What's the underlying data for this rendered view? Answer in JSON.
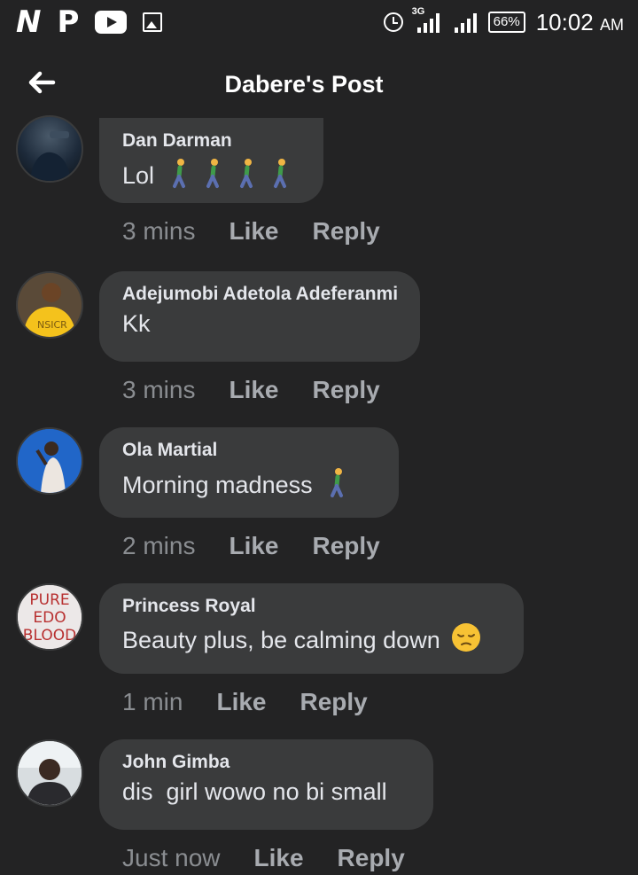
{
  "status_bar": {
    "app_icons": [
      "N",
      "P"
    ],
    "network_type": "3G",
    "battery": "66%",
    "time": "10:02",
    "ampm": "AM"
  },
  "header": {
    "title": "Dabere's Post"
  },
  "actions": {
    "like": "Like",
    "reply": "Reply"
  },
  "comments": [
    {
      "author": "Dan Darman",
      "text": "Lol",
      "emoji": "walking-person x4",
      "time": "3 mins"
    },
    {
      "author": "Adejumobi Adetola Adeferanmi",
      "text": "Kk",
      "time": "3 mins"
    },
    {
      "author": "Ola Martial",
      "text": "Morning madness",
      "emoji": "walking-person",
      "time": "2 mins"
    },
    {
      "author": "Princess Royal",
      "text": "Beauty plus, be calming down",
      "emoji": "pensive-face",
      "time": "1 min",
      "avatar_text": [
        "PURE",
        "EDO",
        "BLOOD"
      ]
    },
    {
      "author": "John Gimba",
      "text": "dis  girl wowo no bi small",
      "time": "Just now"
    }
  ],
  "colors": {
    "background": "#232324",
    "bubble": "#3a3b3c",
    "meta": "#8a8d91"
  }
}
